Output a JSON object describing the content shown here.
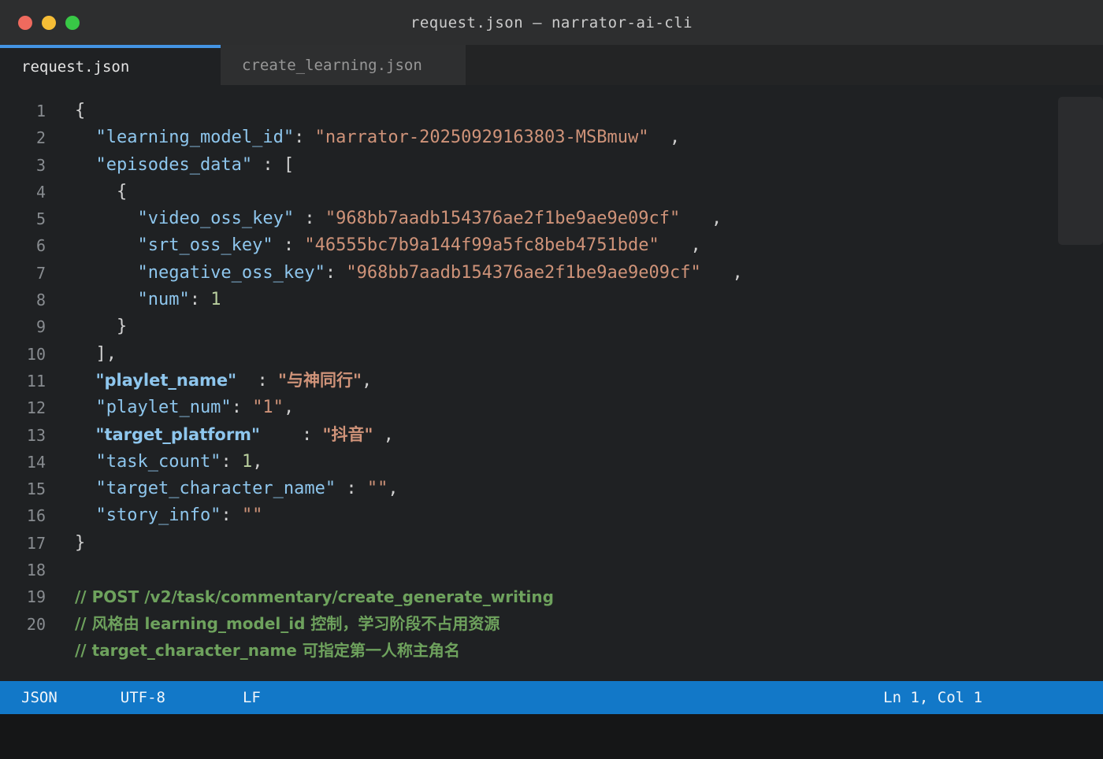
{
  "window": {
    "title": "request.json — narrator-ai-cli"
  },
  "traffic_lights": [
    "close",
    "minimize",
    "zoom"
  ],
  "tabs": [
    {
      "label": "request.json",
      "active": true
    },
    {
      "label": "create_learning.json",
      "active": false
    }
  ],
  "accent_color": "#4494e4",
  "status": {
    "language": "JSON",
    "encoding": "UTF-8",
    "eol": "LF",
    "cursor": "Ln 1, Col 1",
    "bar_color": "#1278c8"
  },
  "editor": {
    "background": "#1f2123",
    "lines": [
      {
        "num": "1",
        "tokens": [
          {
            "t": "{",
            "s": "pun"
          }
        ]
      },
      {
        "num": "2",
        "tokens": [
          {
            "t": "  \"learning_model_id\"",
            "s": "key"
          },
          {
            "t": ": ",
            "s": "pun"
          },
          {
            "t": "\"narrator-20250929163803-MSBmuw\"",
            "s": "str"
          },
          {
            "t": "  ,",
            "s": "pun"
          }
        ]
      },
      {
        "num": "3",
        "tokens": [
          {
            "t": "  \"episodes_data\"",
            "s": "key"
          },
          {
            "t": " : [",
            "s": "pun"
          }
        ]
      },
      {
        "num": "4",
        "tokens": [
          {
            "t": "    {",
            "s": "pun"
          }
        ]
      },
      {
        "num": "5",
        "tokens": [
          {
            "t": "      \"video_oss_key\"",
            "s": "key"
          },
          {
            "t": " : ",
            "s": "pun"
          },
          {
            "t": "\"968bb7aadb154376ae2f1be9ae9e09cf\"",
            "s": "str"
          },
          {
            "t": "   ,",
            "s": "pun"
          }
        ]
      },
      {
        "num": "6",
        "tokens": [
          {
            "t": "      \"srt_oss_key\"",
            "s": "key"
          },
          {
            "t": " : ",
            "s": "pun"
          },
          {
            "t": "\"46555bc7b9a144f99a5fc8beb4751bde\"",
            "s": "str"
          },
          {
            "t": "   ,",
            "s": "pun"
          }
        ]
      },
      {
        "num": "7",
        "tokens": [
          {
            "t": "      \"negative_oss_key\"",
            "s": "key"
          },
          {
            "t": ": ",
            "s": "pun"
          },
          {
            "t": "\"968bb7aadb154376ae2f1be9ae9e09cf\"",
            "s": "str"
          },
          {
            "t": "   ,",
            "s": "pun"
          }
        ]
      },
      {
        "num": "8",
        "tokens": [
          {
            "t": "      \"num\"",
            "s": "key"
          },
          {
            "t": ": ",
            "s": "pun"
          },
          {
            "t": "1",
            "s": "num"
          }
        ]
      },
      {
        "num": "9",
        "tokens": [
          {
            "t": "    }",
            "s": "pun"
          }
        ]
      },
      {
        "num": "10",
        "tokens": [
          {
            "t": "  ],",
            "s": "pun"
          }
        ]
      },
      {
        "num": "11",
        "tokens": [
          {
            "t": "  ",
            "s": "pun"
          },
          {
            "t": "\"playlet_name\"",
            "s": "keyb"
          },
          {
            "t": "  : ",
            "s": "pun"
          },
          {
            "t": "\"与神同行\"",
            "s": "strb"
          },
          {
            "t": ",",
            "s": "pun"
          }
        ]
      },
      {
        "num": "12",
        "tokens": [
          {
            "t": "  \"playlet_num\"",
            "s": "key"
          },
          {
            "t": ": ",
            "s": "pun"
          },
          {
            "t": "\"1\"",
            "s": "str"
          },
          {
            "t": ",",
            "s": "pun"
          }
        ]
      },
      {
        "num": "13",
        "tokens": [
          {
            "t": "  ",
            "s": "pun"
          },
          {
            "t": "\"target_platform\"",
            "s": "keyb"
          },
          {
            "t": "    : ",
            "s": "pun"
          },
          {
            "t": "\"抖音\"",
            "s": "strb"
          },
          {
            "t": " ,",
            "s": "pun"
          }
        ]
      },
      {
        "num": "14",
        "tokens": [
          {
            "t": "  \"task_count\"",
            "s": "key"
          },
          {
            "t": ": ",
            "s": "pun"
          },
          {
            "t": "1",
            "s": "num"
          },
          {
            "t": ",",
            "s": "pun"
          }
        ]
      },
      {
        "num": "15",
        "tokens": [
          {
            "t": "  \"target_character_name\"",
            "s": "key"
          },
          {
            "t": " : ",
            "s": "pun"
          },
          {
            "t": "\"\"",
            "s": "str"
          },
          {
            "t": ",",
            "s": "pun"
          }
        ]
      },
      {
        "num": "16",
        "tokens": [
          {
            "t": "  \"story_info\"",
            "s": "key"
          },
          {
            "t": ": ",
            "s": "pun"
          },
          {
            "t": "\"\"",
            "s": "str"
          }
        ]
      },
      {
        "num": "17",
        "tokens": [
          {
            "t": "}",
            "s": "pun"
          }
        ]
      },
      {
        "num": "18",
        "tokens": []
      },
      {
        "num": "19",
        "tokens": [
          {
            "t": "// POST /v2/task/commentary/create_generate_writing",
            "s": "cmt"
          }
        ]
      },
      {
        "num": "20",
        "tokens": [
          {
            "t": "// 风格由 learning_model_id 控制，学习阶段不占用资源",
            "s": "cmt"
          }
        ]
      },
      {
        "num": "",
        "tokens": [
          {
            "t": "// target_character_name 可指定第一人称主角名",
            "s": "cmt"
          }
        ]
      }
    ]
  }
}
